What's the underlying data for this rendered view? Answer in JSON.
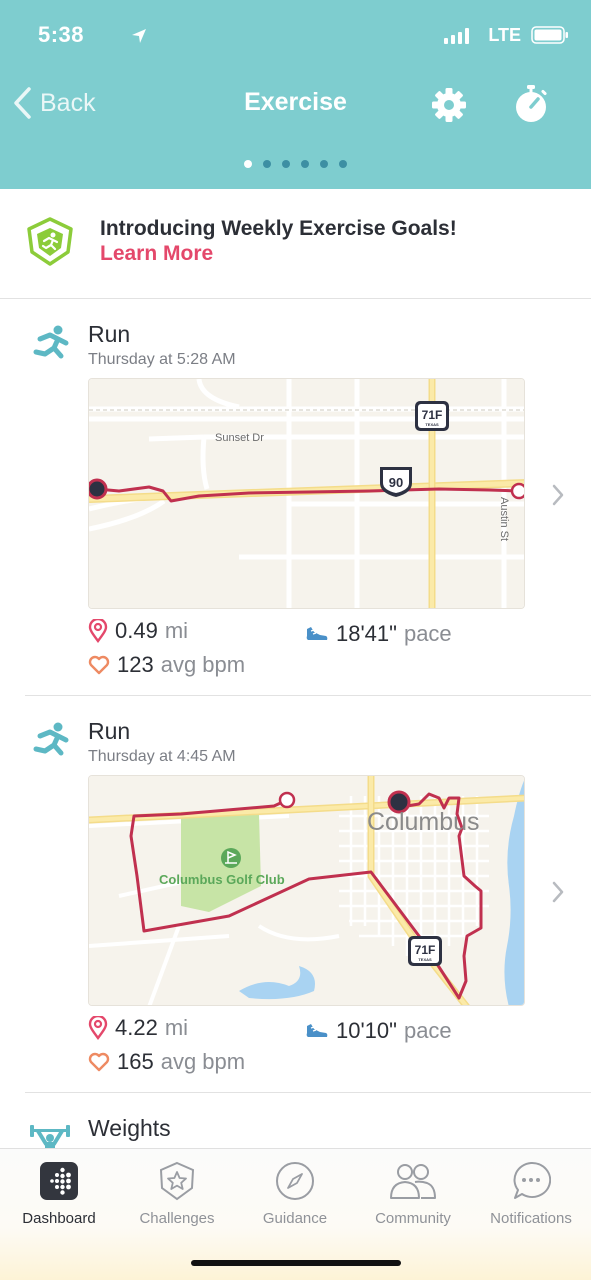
{
  "status_bar": {
    "time": "5:38",
    "network": "LTE"
  },
  "nav": {
    "back_label": "Back",
    "title": "Exercise",
    "page_count": 6,
    "active_page": 1
  },
  "banner": {
    "headline": "Introducing Weekly Exercise Goals!",
    "link": "Learn More"
  },
  "activities": [
    {
      "name": "Run",
      "when": "Thursday at 5:28 AM",
      "distance": "0.49",
      "distance_unit": "mi",
      "pace": "18'41\"",
      "pace_label": "pace",
      "bpm": "123",
      "bpm_label": "avg bpm",
      "map": {
        "labels": [
          "Sunset Dr",
          "Austin St"
        ],
        "shields": [
          "71F",
          "90"
        ],
        "shield_sub": "TEXAS"
      }
    },
    {
      "name": "Run",
      "when": "Thursday at 4:45 AM",
      "distance": "4.22",
      "distance_unit": "mi",
      "pace": "10'10\"",
      "pace_label": "pace",
      "bpm": "165",
      "bpm_label": "avg bpm",
      "map": {
        "labels": [
          "Columbus",
          "Columbus Golf Club"
        ],
        "shields": [
          "71F"
        ],
        "shield_sub": "TEXAS"
      }
    },
    {
      "name": "Weights"
    }
  ],
  "tabs": [
    {
      "label": "Dashboard",
      "icon": "dashboard-icon",
      "active": true
    },
    {
      "label": "Challenges",
      "icon": "star-badge-icon",
      "active": false
    },
    {
      "label": "Guidance",
      "icon": "compass-icon",
      "active": false
    },
    {
      "label": "Community",
      "icon": "people-icon",
      "active": false
    },
    {
      "label": "Notifications",
      "icon": "speech-bubble-icon",
      "active": false
    }
  ],
  "colors": {
    "header": "#7ecdcf",
    "accent_pink": "#e4486b",
    "run_icon": "#5db8c4",
    "route": "#c0304f",
    "badge_green": "#8ccc3a"
  }
}
